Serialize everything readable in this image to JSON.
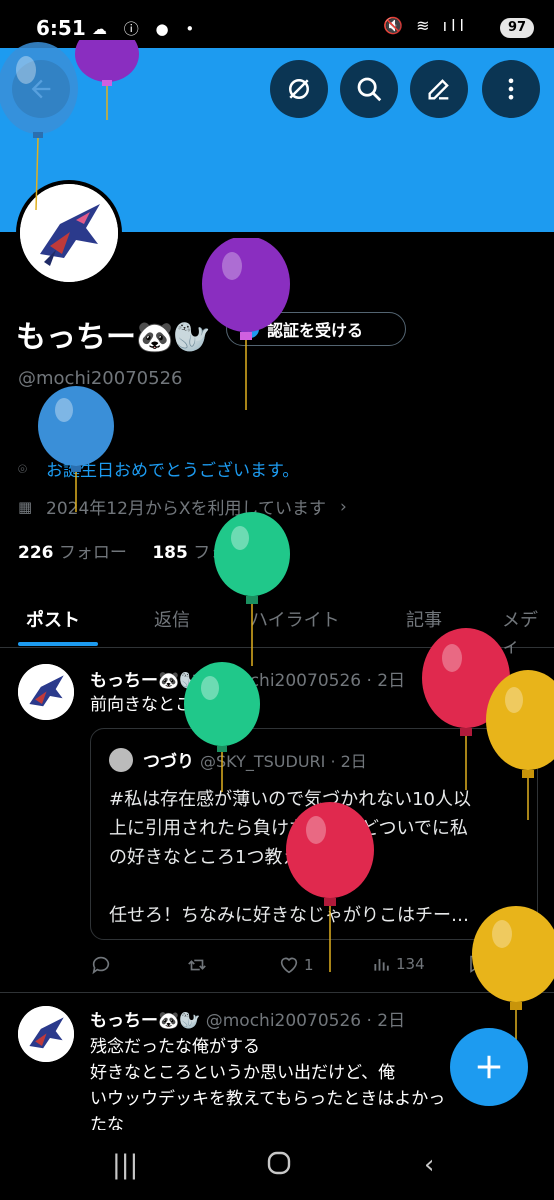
{
  "statusbar": {
    "time": "6:51",
    "battery": "97"
  },
  "profile": {
    "display_name": "もっちー🐼🦭",
    "verify_button": "認証を受ける",
    "handle": "@mochi20070526",
    "bio_location": "お誕生日おめでとうございます。",
    "joined": "2024年12月からXを利用しています",
    "following_count": "226",
    "following_label": "フォロー",
    "followers_count": "185",
    "followers_label": "フォロワー"
  },
  "tabs": [
    "ポスト",
    "返信",
    "ハイライト",
    "記事",
    "メディ"
  ],
  "posts": [
    {
      "name": "もっちー🐼🦭",
      "handle": "@mochi20070526 · 2日",
      "text": "前向きなところ",
      "quote": {
        "name": "つづり",
        "handle": "@SKY_TSUDURI · 2日",
        "line1": "#私は存在感が薄いので気づかれない10人以",
        "line2": "上に引用されたら負けなんだけどついでに私",
        "line3": "の好きなところ1つ教えて下さい",
        "line4": "任せろ！ちなみに好きなじゃがりこはチー…"
      },
      "likes": "1",
      "views": "134"
    },
    {
      "name": "もっちー🐼🦭",
      "handle": "@mochi20070526 · 2日",
      "line1": "残念だったな俺がする",
      "line2": "好きなところというか思い出だけど、俺",
      "line3": "いウッウデッキを教えてもらったときはよかっ",
      "line4": "たな"
    }
  ],
  "colors": {
    "accent": "#1d9bf0",
    "banner": "#1d9bf0",
    "muted": "#71767b"
  },
  "icons": [
    "back-arrow-icon",
    "no-edit-icon",
    "search-icon",
    "pencil-icon",
    "more-vertical-icon",
    "location-icon",
    "calendar-icon",
    "chevron-right-icon",
    "reply-icon",
    "retweet-icon",
    "heart-icon",
    "views-icon",
    "bookmark-icon",
    "share-icon",
    "plus-icon"
  ]
}
